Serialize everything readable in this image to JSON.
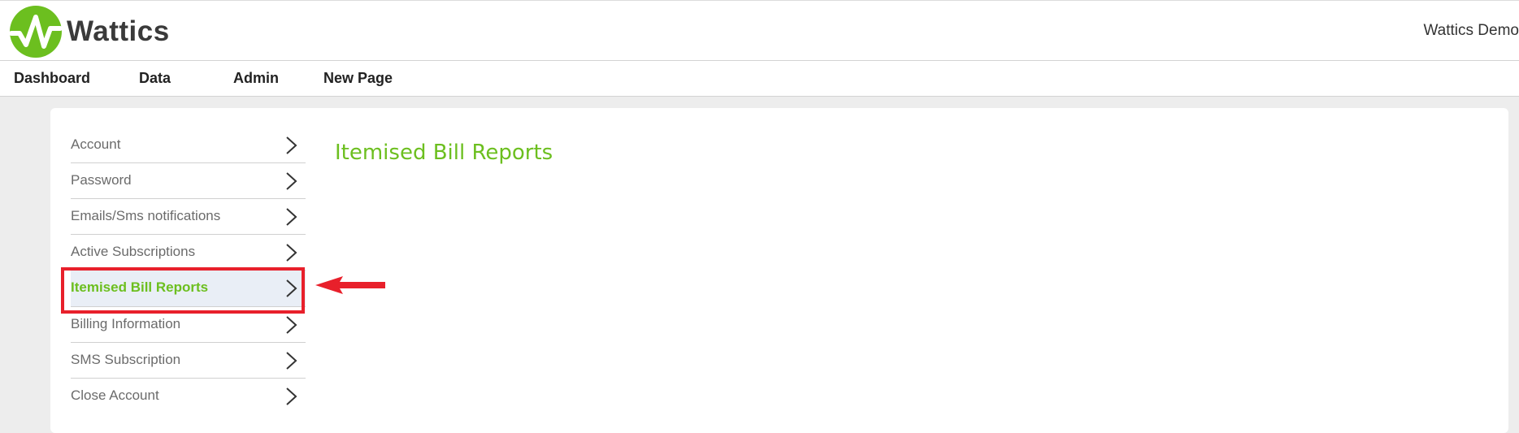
{
  "brand": {
    "name": "Wattics",
    "logo_icon": "wattics-pulse-logo-icon",
    "logo_color": "#6cbf1f"
  },
  "header": {
    "user_label": "Wattics Demo"
  },
  "nav": {
    "items": [
      {
        "label": "Dashboard"
      },
      {
        "label": "Data"
      },
      {
        "label": "Admin"
      },
      {
        "label": "New Page"
      }
    ]
  },
  "sidebar": {
    "items": [
      {
        "label": "Account",
        "icon": "chevron-right-icon"
      },
      {
        "label": "Password",
        "icon": "chevron-right-icon"
      },
      {
        "label": "Emails/Sms notifications",
        "icon": "chevron-right-icon"
      },
      {
        "label": "Active Subscriptions",
        "icon": "chevron-right-icon"
      },
      {
        "label": "Itemised Bill Reports",
        "icon": "chevron-right-icon",
        "active": true
      },
      {
        "label": "Billing Information",
        "icon": "chevron-right-icon"
      },
      {
        "label": "SMS Subscription",
        "icon": "chevron-right-icon"
      },
      {
        "label": "Close Account",
        "icon": "chevron-right-icon"
      }
    ]
  },
  "main": {
    "title": "Itemised Bill Reports"
  },
  "annotation": {
    "highlight_color": "#e8202b",
    "arrow_icon": "left-arrow-annotation"
  },
  "colors": {
    "accent": "#6cbf1f",
    "active_bg": "#e9eef6",
    "page_bg": "#ededed"
  }
}
